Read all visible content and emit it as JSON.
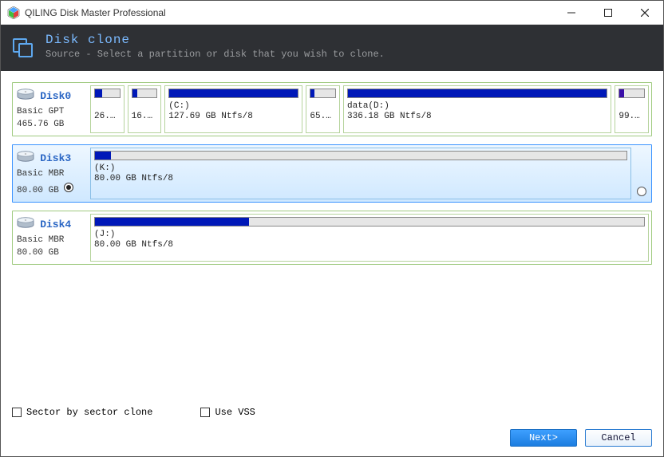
{
  "window_title": "QILING Disk Master Professional",
  "header": {
    "title": "Disk clone",
    "subtitle": "Source - Select a partition or disk that you wish to clone."
  },
  "disks": [
    {
      "name": "Disk0",
      "scheme": "Basic GPT",
      "size": "465.76 GB",
      "selected": false,
      "show_radio_left": false,
      "show_radio_right": false,
      "partitions": [
        {
          "label1": "",
          "label2": "26...",
          "weight": 6,
          "fill": 30,
          "color": "blue"
        },
        {
          "label1": "",
          "label2": "16...",
          "weight": 6,
          "fill": 20,
          "color": "blue"
        },
        {
          "label1": "(C:)",
          "label2": "127.69 GB Ntfs/8",
          "weight": 30,
          "fill": 100,
          "color": "blue"
        },
        {
          "label1": "",
          "label2": "65...",
          "weight": 6,
          "fill": 15,
          "color": "blue"
        },
        {
          "label1": "data(D:)",
          "label2": "336.18 GB Ntfs/8",
          "weight": 60,
          "fill": 100,
          "color": "blue"
        },
        {
          "label1": "",
          "label2": "99...",
          "weight": 6,
          "fill": 20,
          "color": "purple"
        }
      ]
    },
    {
      "name": "Disk3",
      "scheme": "Basic MBR",
      "size": "80.00 GB",
      "selected": true,
      "show_radio_left": true,
      "radio_left_checked": true,
      "show_radio_right": true,
      "radio_right_checked": false,
      "partitions": [
        {
          "label1": "(K:)",
          "label2": "80.00 GB Ntfs/8",
          "weight": 100,
          "fill": 3,
          "color": "blue"
        }
      ]
    },
    {
      "name": "Disk4",
      "scheme": "Basic MBR",
      "size": "80.00 GB",
      "selected": false,
      "show_radio_left": false,
      "show_radio_right": false,
      "partitions": [
        {
          "label1": "(J:)",
          "label2": "80.00 GB Ntfs/8",
          "weight": 100,
          "fill": 28,
          "color": "blue"
        }
      ]
    }
  ],
  "options": {
    "sector_by_sector": {
      "label": "Sector by sector clone",
      "checked": false
    },
    "use_vss": {
      "label": "Use VSS",
      "checked": false
    }
  },
  "buttons": {
    "next": "Next>",
    "cancel": "Cancel"
  }
}
